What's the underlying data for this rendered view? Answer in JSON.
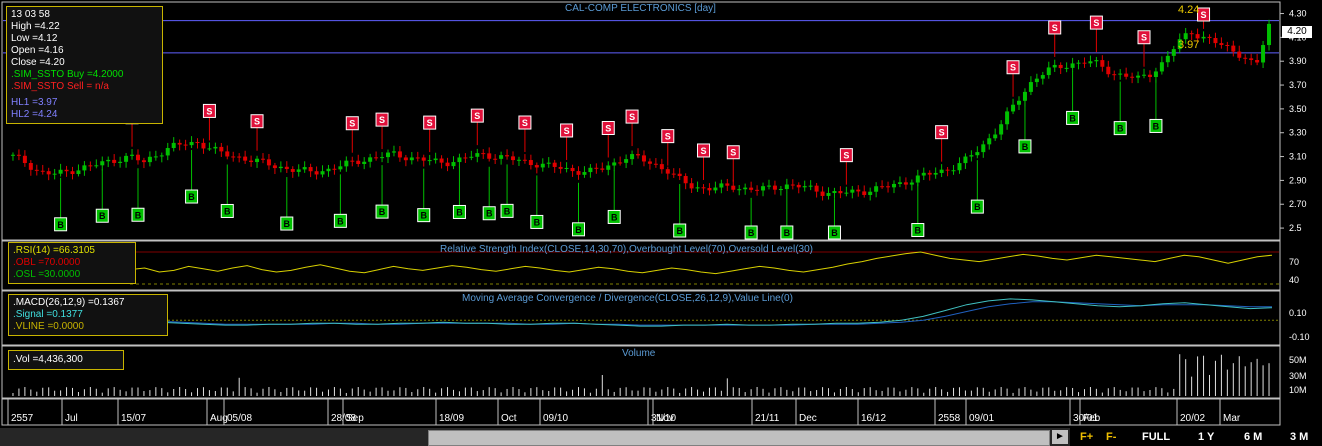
{
  "chart_data": {
    "type": "candlestick",
    "title": "CAL-COMP ELECTRONICS [day]",
    "price_ticks": [
      "4.30",
      "4.10",
      "3.90",
      "3.70",
      "3.50",
      "3.30",
      "3.10",
      "2.90",
      "2.70",
      "2.5"
    ],
    "current_price_label": "4.20",
    "hl_lines": [
      {
        "label": "4.24",
        "value": 4.24
      },
      {
        "label": "3.97",
        "value": 3.97
      }
    ],
    "x_ticks": [
      "2557",
      "Jul",
      "15/07",
      "Aug",
      "05/08",
      "28/08",
      "Sep",
      "18/09",
      "Oct",
      "09/10",
      "31/10",
      "Nov",
      "21/11",
      "Dec",
      "16/12",
      "2558",
      "09/01",
      "30/01",
      "Feb",
      "20/02",
      "Mar"
    ],
    "close_series": [
      3.1,
      3.05,
      2.97,
      2.95,
      2.97,
      3.0,
      3.02,
      3.05,
      3.08,
      3.1,
      3.05,
      3.12,
      3.18,
      3.2,
      3.22,
      3.18,
      3.12,
      3.1,
      3.08,
      3.05,
      3.02,
      3.0,
      2.98,
      2.97,
      2.99,
      3.02,
      3.05,
      3.08,
      3.1,
      3.12,
      3.1,
      3.08,
      3.06,
      3.05,
      3.07,
      3.1,
      3.12,
      3.1,
      3.08,
      3.06,
      3.04,
      3.02,
      3.0,
      2.98,
      2.97,
      3.0,
      3.05,
      3.1,
      3.08,
      3.04,
      2.98,
      2.9,
      2.85,
      2.83,
      2.84,
      2.85,
      2.83,
      2.82,
      2.84,
      2.86,
      2.85,
      2.83,
      2.8,
      2.79,
      2.8,
      2.81,
      2.83,
      2.85,
      2.88,
      2.92,
      2.95,
      2.98,
      3.02,
      3.08,
      3.18,
      3.3,
      3.45,
      3.6,
      3.75,
      3.82,
      3.85,
      3.88,
      3.9,
      3.87,
      3.8,
      3.78,
      3.75,
      3.8,
      3.9,
      4.05,
      4.15,
      4.1,
      4.05,
      4.0,
      3.95,
      3.85,
      4.2
    ],
    "buy_signal_indices": [
      8,
      15,
      21,
      30,
      36,
      46,
      55,
      62,
      69,
      75,
      80,
      83,
      88,
      95,
      101,
      112,
      124,
      130,
      138,
      152,
      162,
      170,
      178,
      186,
      192
    ],
    "sell_signal_indices": [
      20,
      33,
      41,
      57,
      62,
      70,
      78,
      86,
      93,
      100,
      104,
      110,
      116,
      121,
      140,
      156,
      168,
      175,
      182,
      190,
      200
    ],
    "rsi_panel": {
      "title": "Relative Strength Index(CLOSE,14,30,70),Overbought Level(70),Oversold Level(30)",
      "ticks": [
        "70",
        "40"
      ],
      "series": [
        48,
        50,
        45,
        47,
        52,
        49,
        46,
        50,
        53,
        48,
        45,
        47,
        51,
        54,
        50,
        46,
        44,
        48,
        52,
        49,
        47,
        50,
        53,
        51,
        48,
        46,
        49,
        52,
        50,
        47,
        45,
        48,
        51,
        49,
        46,
        44,
        47,
        50,
        48,
        45,
        43,
        46,
        49,
        52,
        50,
        47,
        45,
        48,
        51,
        55,
        58,
        62,
        65,
        68,
        70,
        66,
        62,
        60,
        58,
        61,
        64,
        67,
        65,
        62,
        60,
        63,
        66,
        64,
        62,
        60,
        58,
        62,
        66,
        64,
        60,
        56,
        60,
        64,
        66
      ]
    },
    "macd_panel": {
      "title": "Moving Average Convergence / Divergence(CLOSE,26,12,9),Value Line(0)",
      "ticks": [
        "0.10",
        "-0.10"
      ],
      "macd": [
        -0.02,
        -0.03,
        -0.04,
        -0.05,
        -0.05,
        -0.04,
        -0.04,
        -0.03,
        -0.03,
        -0.04,
        -0.04,
        -0.03,
        -0.03,
        -0.02,
        -0.03,
        -0.03,
        -0.04,
        -0.04,
        -0.03,
        -0.03,
        -0.04,
        -0.05,
        -0.06,
        -0.06,
        -0.05,
        -0.05,
        -0.04,
        -0.05,
        -0.05,
        -0.04,
        -0.04,
        -0.03,
        -0.03,
        -0.02,
        0.0,
        0.04,
        0.1,
        0.16,
        0.2,
        0.22,
        0.21,
        0.19,
        0.17,
        0.15,
        0.14,
        0.15,
        0.17,
        0.18,
        0.16,
        0.14,
        0.12,
        0.13
      ],
      "signal": [
        -0.01,
        -0.02,
        -0.03,
        -0.04,
        -0.04,
        -0.04,
        -0.04,
        -0.04,
        -0.03,
        -0.03,
        -0.04,
        -0.04,
        -0.03,
        -0.03,
        -0.03,
        -0.03,
        -0.03,
        -0.04,
        -0.04,
        -0.03,
        -0.04,
        -0.04,
        -0.05,
        -0.05,
        -0.05,
        -0.05,
        -0.05,
        -0.05,
        -0.05,
        -0.05,
        -0.04,
        -0.04,
        -0.04,
        -0.03,
        -0.02,
        0.0,
        0.04,
        0.09,
        0.14,
        0.17,
        0.19,
        0.19,
        0.18,
        0.17,
        0.16,
        0.15,
        0.16,
        0.16,
        0.16,
        0.15,
        0.14,
        0.14
      ]
    },
    "volume_panel": {
      "title": "Volume",
      "ticks": [
        "50M",
        "30M",
        "10M"
      ]
    }
  },
  "info_box": {
    "time": "13 03 58",
    "high": "High  =4.22",
    "low": "Low  =4.12",
    "open": "Open  =4.16",
    "close": "Close  =4.20",
    "sim_buy": ".SIM_SSTO Buy   =4.2000",
    "sim_sell": ".SIM_SSTO Sell   = n/a",
    "hl1": "HL1 =3.97",
    "hl2": "HL2 =4.24"
  },
  "rsi_info": {
    "rsi": ".RSI(14)   =66.3105",
    "obl": ".OBL   =70.0000",
    "osl": ".OSL   =30.0000"
  },
  "macd_info": {
    "macd": ".MACD(26,12,9)   =0.1367",
    "signal": ".Signal   =0.1377",
    "vline": ".VLINE   =0.0000"
  },
  "vol_info": {
    "vol": ".Vol   =4,436,300"
  },
  "status_bar": {
    "f_plus": "F+",
    "f_minus": "F-",
    "buttons": [
      "FULL",
      "1 Y",
      "6 M",
      "3 M"
    ]
  },
  "colors": {
    "up": "#00c000",
    "down": "#e00000",
    "buy": "#00c000",
    "sell": "#e0103a",
    "rsi": "#d8d000",
    "macd": "#40c0c0",
    "hl": "#6060ff"
  }
}
